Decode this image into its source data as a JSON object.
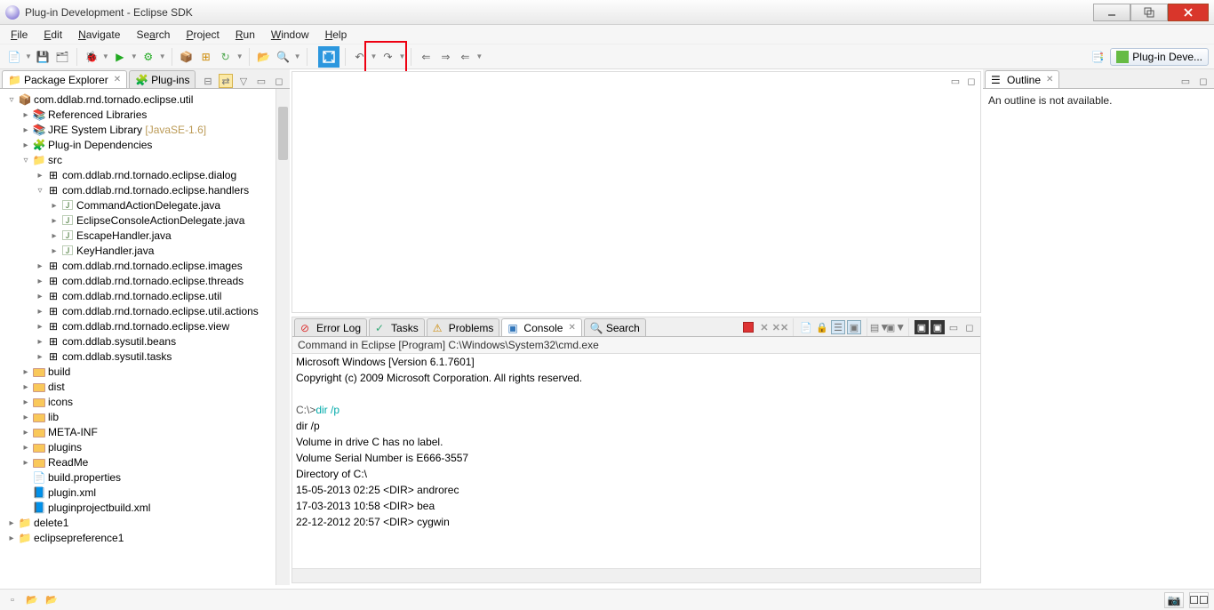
{
  "window": {
    "title": "Plug-in Development - Eclipse SDK"
  },
  "menubar": [
    "File",
    "Edit",
    "Navigate",
    "Search",
    "Project",
    "Run",
    "Window",
    "Help"
  ],
  "annotation": {
    "label": "Full Screen"
  },
  "perspective": {
    "button_label": "Plug-in Deve..."
  },
  "left_panel": {
    "tab_active": "Package Explorer",
    "tab_inactive": "Plug-ins",
    "tree": {
      "project": "com.ddlab.rnd.tornado.eclipse.util",
      "ref_lib": "Referenced Libraries",
      "jre": "JRE System Library",
      "jre_suffix": "[JavaSE-1.6]",
      "plugdep": "Plug-in Dependencies",
      "src": "src",
      "packages": [
        "com.ddlab.rnd.tornado.eclipse.dialog",
        "com.ddlab.rnd.tornado.eclipse.handlers",
        "com.ddlab.rnd.tornado.eclipse.images",
        "com.ddlab.rnd.tornado.eclipse.threads",
        "com.ddlab.rnd.tornado.eclipse.util",
        "com.ddlab.rnd.tornado.eclipse.util.actions",
        "com.ddlab.rnd.tornado.eclipse.view",
        "com.ddlab.sysutil.beans",
        "com.ddlab.sysutil.tasks"
      ],
      "java_files": [
        "CommandActionDelegate.java",
        "EclipseConsoleActionDelegate.java",
        "EscapeHandler.java",
        "KeyHandler.java"
      ],
      "folders": [
        "build",
        "dist",
        "icons",
        "lib",
        "META-INF",
        "plugins",
        "ReadMe"
      ],
      "files": [
        "build.properties",
        "plugin.xml",
        "pluginprojectbuild.xml"
      ],
      "other_projects": [
        "delete1",
        "eclipsepreference1"
      ]
    }
  },
  "outline": {
    "tab": "Outline",
    "message": "An outline is not available."
  },
  "console": {
    "tabs": [
      "Error Log",
      "Tasks",
      "Problems",
      "Console",
      "Search"
    ],
    "active_tab": "Console",
    "path": "Command in Eclipse [Program] C:\\Windows\\System32\\cmd.exe",
    "line1": "Microsoft Windows [Version 6.1.7601]",
    "line2": "Copyright (c) 2009 Microsoft Corporation.  All rights reserved.",
    "prompt": "C:\\>",
    "cmd": "dir /p",
    "out": [
      "dir /p",
      " Volume in drive C has no label.",
      " Volume Serial Number is E666-3557",
      "",
      " Directory of C:\\",
      "",
      "15-05-2013  02:25    <DIR>          androrec",
      "17-03-2013  10:58    <DIR>          bea",
      "22-12-2012  20:57    <DIR>          cygwin"
    ]
  }
}
